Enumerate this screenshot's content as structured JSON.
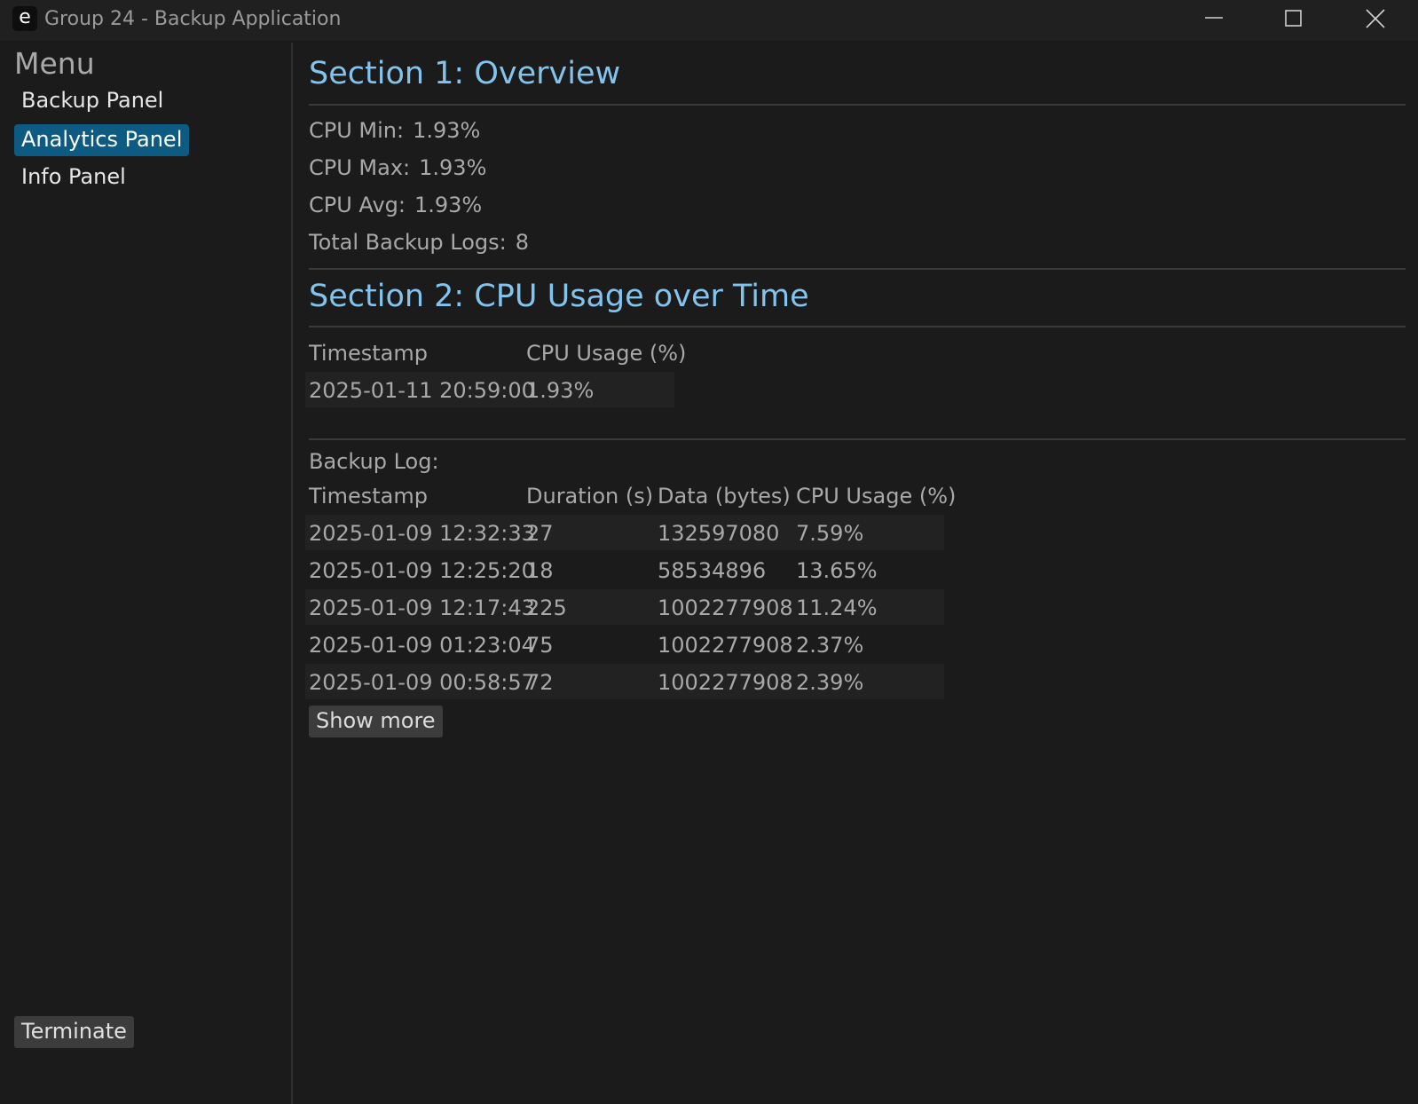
{
  "window": {
    "icon_letter": "e",
    "title": "Group 24 - Backup Application"
  },
  "sidebar": {
    "title": "Menu",
    "items": [
      {
        "label": "Backup Panel",
        "active": false
      },
      {
        "label": "Analytics Panel",
        "active": true
      },
      {
        "label": "Info Panel",
        "active": false
      }
    ],
    "terminate_label": "Terminate"
  },
  "overview": {
    "heading": "Section 1: Overview",
    "stats": [
      {
        "label": "CPU Min:",
        "value": "1.93%"
      },
      {
        "label": "CPU Max:",
        "value": "1.93%"
      },
      {
        "label": "CPU Avg:",
        "value": "1.93%"
      },
      {
        "label": "Total Backup Logs:",
        "value": "8"
      }
    ]
  },
  "cpu_over_time": {
    "heading": "Section 2: CPU Usage over Time",
    "headers": [
      "Timestamp",
      "CPU Usage (%)"
    ],
    "rows": [
      [
        "2025-01-11 20:59:00",
        "1.93%"
      ]
    ]
  },
  "backup_log": {
    "title": "Backup Log:",
    "headers": [
      "Timestamp",
      "Duration (s)",
      "Data (bytes)",
      "CPU Usage (%)"
    ],
    "rows": [
      [
        "2025-01-09 12:32:33",
        "27",
        "132597080",
        "7.59%"
      ],
      [
        "2025-01-09 12:25:20",
        "18",
        "58534896",
        "13.65%"
      ],
      [
        "2025-01-09 12:17:43",
        "225",
        "1002277908",
        "11.24%"
      ],
      [
        "2025-01-09 01:23:04",
        "75",
        "1002277908",
        "2.37%"
      ],
      [
        "2025-01-09 00:58:57",
        "72",
        "1002277908",
        "2.39%"
      ]
    ],
    "show_more_label": "Show more"
  },
  "colors": {
    "background": "#1b1b1b",
    "heading": "#82c4ee",
    "active_nav": "#0d5b82",
    "text": "#a9a9a9"
  }
}
